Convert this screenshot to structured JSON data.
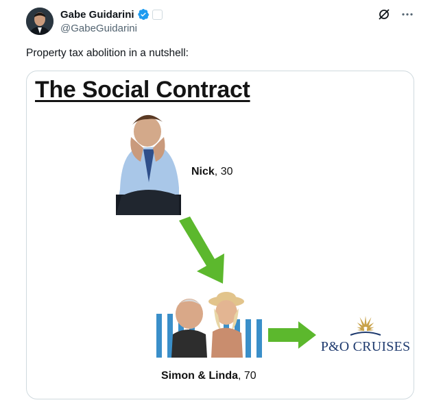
{
  "post": {
    "author_name": "Gabe Guidarini",
    "handle": "@GabeGuidarini",
    "text": "Property tax abolition in a nutshell:"
  },
  "icons": {
    "verified": "verified-badge-icon",
    "affiliate": "affiliate-badge-icon",
    "grok": "grok-icon",
    "more": "more-icon"
  },
  "media": {
    "title": "The Social Contract",
    "person1_name": "Nick",
    "person1_age": ", 30",
    "couple_names": "Simon & Linda",
    "couple_age": ", 70",
    "brand_text": "P&O CRUISES"
  },
  "colors": {
    "verified_blue": "#1d9bf0",
    "arrow_green": "#5cb82d",
    "brand_navy": "#1e3a6e",
    "brand_gold": "#c8a24a"
  }
}
